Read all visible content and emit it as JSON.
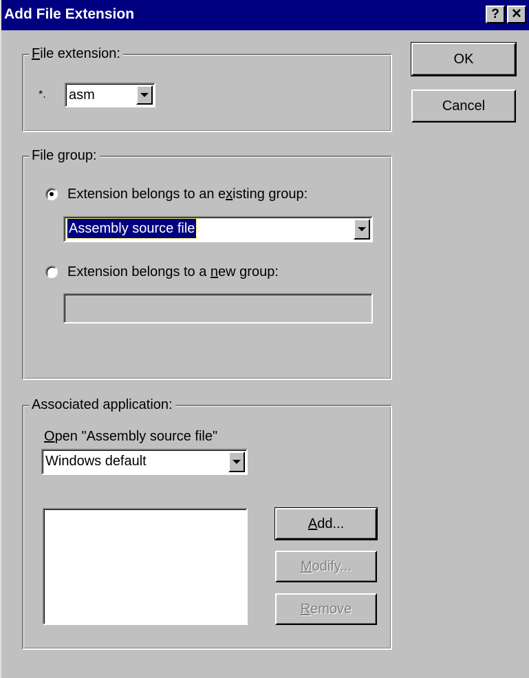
{
  "window": {
    "title": "Add File Extension",
    "help_button": "?",
    "close_button": "✕"
  },
  "buttons": {
    "ok": "OK",
    "cancel": "Cancel"
  },
  "file_extension": {
    "group_label_prefix": "",
    "group_label_mnemonic": "F",
    "group_label_rest": "ile extension:",
    "prefix": "*.",
    "value": "asm"
  },
  "file_group": {
    "group_label": "File group:",
    "existing": {
      "label_before": "Extension belongs to an e",
      "label_mnemonic": "x",
      "label_after": "isting group:",
      "selected": true,
      "combo_value": "Assembly source file"
    },
    "new": {
      "label_before": "Extension belongs to a ",
      "label_mnemonic": "n",
      "label_after": "ew group:",
      "selected": false,
      "field_value": ""
    }
  },
  "associated_application": {
    "group_label": "Associated application:",
    "open_label_mnemonic": "O",
    "open_label_rest": "pen \"Assembly source file\"",
    "combo_value": "Windows default",
    "list_items": [],
    "add_mnemonic": "A",
    "add_rest": "dd...",
    "modify_mnemonic": "M",
    "modify_rest": "odify...",
    "remove_mnemonic": "R",
    "remove_rest": "emove"
  },
  "colors": {
    "title_bar": "#000080",
    "dialog_face": "#c0c0c0",
    "selection": "#000080"
  }
}
